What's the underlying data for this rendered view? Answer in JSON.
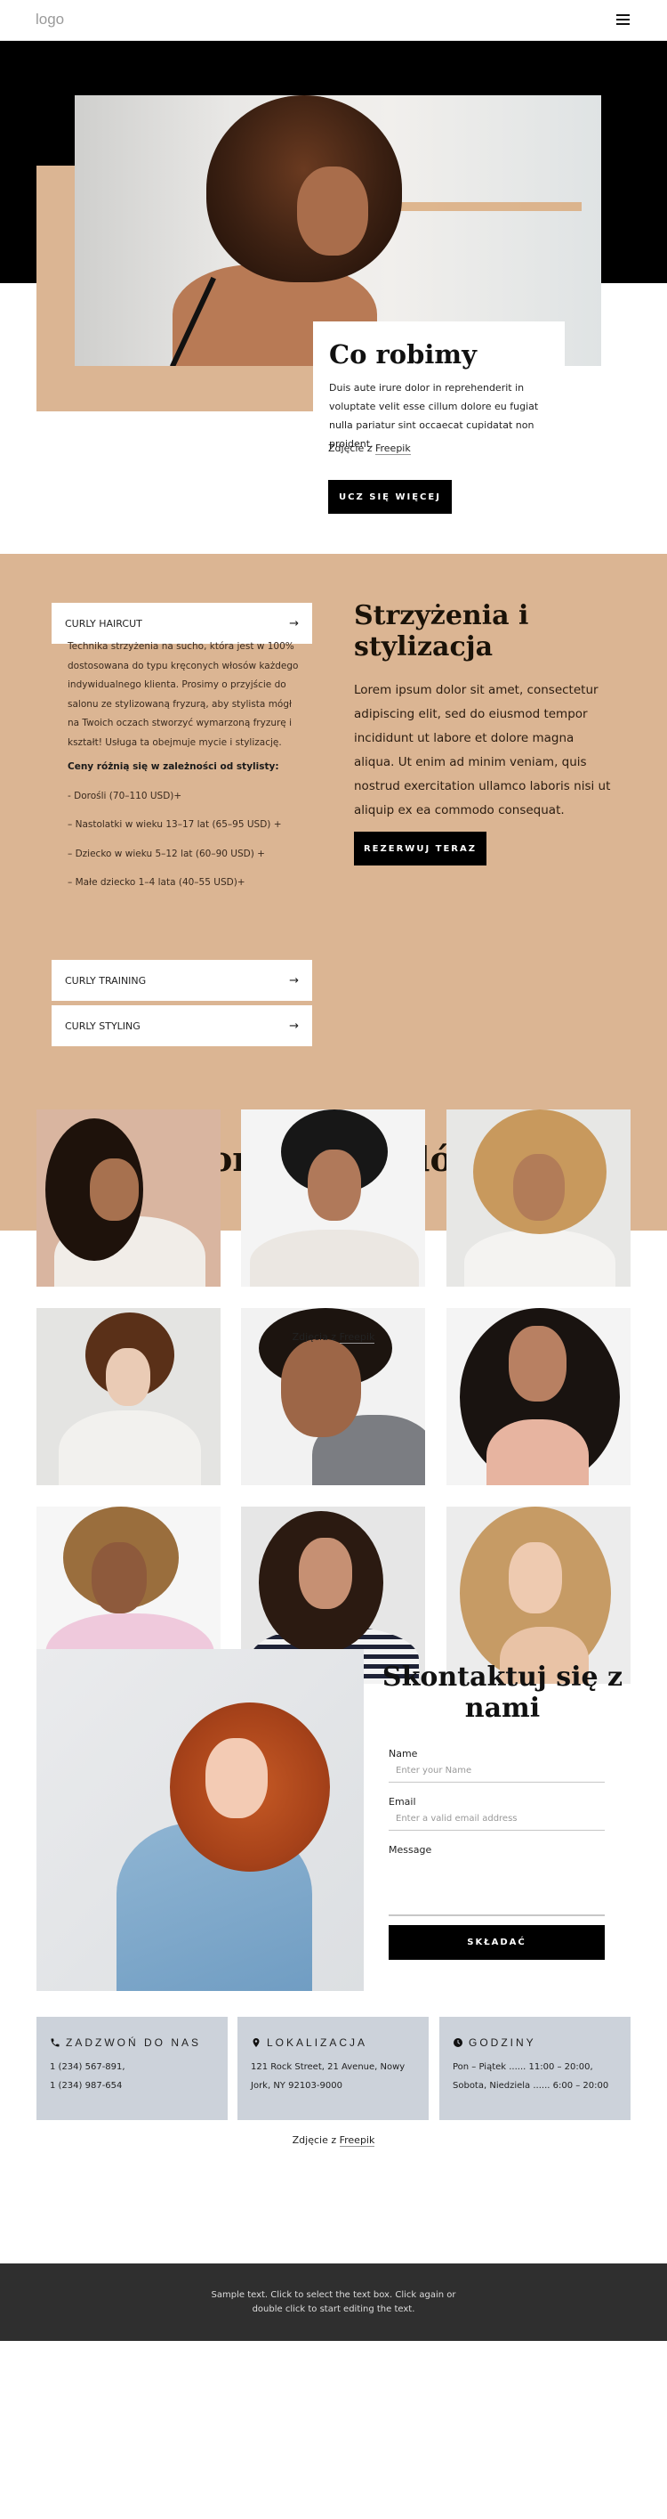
{
  "header": {
    "logo": "logo",
    "menu_icon": "hamburger-menu-icon"
  },
  "hero": {
    "title": "Co robimy",
    "text": "Duis aute irure dolor in reprehenderit in voluptate velit esse cillum dolore eu fugiat nulla pariatur sint occaecat cupidatat non proident.",
    "credit_prefix": "Zdjęcie z",
    "credit_link": "Freepik",
    "button": "UCZ SIĘ WIĘCEJ"
  },
  "services": {
    "accordion": [
      {
        "label": "CURLY HAIRCUT",
        "icon": "arrow-right-icon",
        "expanded": true
      },
      {
        "label": "CURLY TRAINING",
        "icon": "arrow-right-icon",
        "expanded": false
      },
      {
        "label": "CURLY STYLING",
        "icon": "arrow-right-icon",
        "expanded": false
      }
    ],
    "haircut_description": "Technika strzyżenia na sucho, która jest w 100% dostosowana do typu kręconych włosów każdego indywidualnego klienta. Prosimy o przyjście do salonu ze stylizowaną fryzurą, aby stylista mógł na Twoich oczach stworzyć wymarzoną fryzurę i kształt! Usługa ta obejmuje mycie i stylizację.",
    "prices_heading": "Ceny różnią się w zależności od stylisty:",
    "prices": [
      "- Dorośli (70–110 USD)+",
      "– Nastolatki w wieku 13–17 lat (65–95 USD) +",
      "– Dziecko w wieku 5–12 lat (60–90 USD) +",
      "– Małe dziecko 1–4 lata (40–55 USD)+"
    ],
    "title": "Strzyżenia i stylizacja",
    "text": "Lorem ipsum dolor sit amet, consectetur adipiscing elit, sed do eiusmod tempor incididunt ut labore et dolore magna aliqua. Ut enim ad minim veniam, quis nostrud exercitation ullamco laboris nisi ut aliquip ex ea commodo consequat.",
    "button": "REZERWUJ TERAZ"
  },
  "portfolio": {
    "title": "Portfolio stylów",
    "credit_prefix": "Zdjęcia z",
    "credit_link": "Freepik",
    "photos": [
      {
        "alt": "woman with long dark curly hair in white sweater"
      },
      {
        "alt": "man with afro and glasses thinking"
      },
      {
        "alt": "woman with blonde afro smiling"
      },
      {
        "alt": "woman with short brown curly hair"
      },
      {
        "alt": "man with curly hair in grey shirt"
      },
      {
        "alt": "woman with long black curly hair smiling"
      },
      {
        "alt": "woman with blonde curly bob in pink sweater"
      },
      {
        "alt": "woman with dark curly hair in striped shirt"
      },
      {
        "alt": "woman with long blonde curly hair"
      }
    ]
  },
  "contact": {
    "title": "Skontaktuj się z nami",
    "photo_alt": "woman with red curly hair in denim shirt",
    "form": {
      "name_label": "Name",
      "name_placeholder": "Enter your Name",
      "email_label": "Email",
      "email_placeholder": "Enter a valid email address",
      "message_label": "Message",
      "submit": "SKŁADAĆ"
    },
    "cards": [
      {
        "icon": "phone-icon",
        "title": "ZADZWOŃ DO NAS",
        "lines": [
          "1 (234) 567-891,",
          "1 (234) 987-654"
        ]
      },
      {
        "icon": "map-pin-icon",
        "title": "LOKALIZACJA",
        "lines": [
          "121 Rock Street, 21 Avenue, Nowy",
          "Jork, NY 92103-9000"
        ]
      },
      {
        "icon": "clock-icon",
        "title": "GODZINY",
        "lines": [
          "Pon – Piątek ...... 11:00 – 20:00,",
          "Sobota, Niedziela ...... 6:00 – 20:00"
        ]
      }
    ],
    "credit_prefix": "Zdjęcie z",
    "credit_link": "Freepik"
  },
  "footer": {
    "text": "Sample text. Click to select the text box. Click again or double click to start editing the text."
  },
  "colors": {
    "accent_tan": "#dbb593",
    "black": "#000000",
    "info_card": "#ccd2da",
    "footer_bg": "#2f2f2f"
  }
}
